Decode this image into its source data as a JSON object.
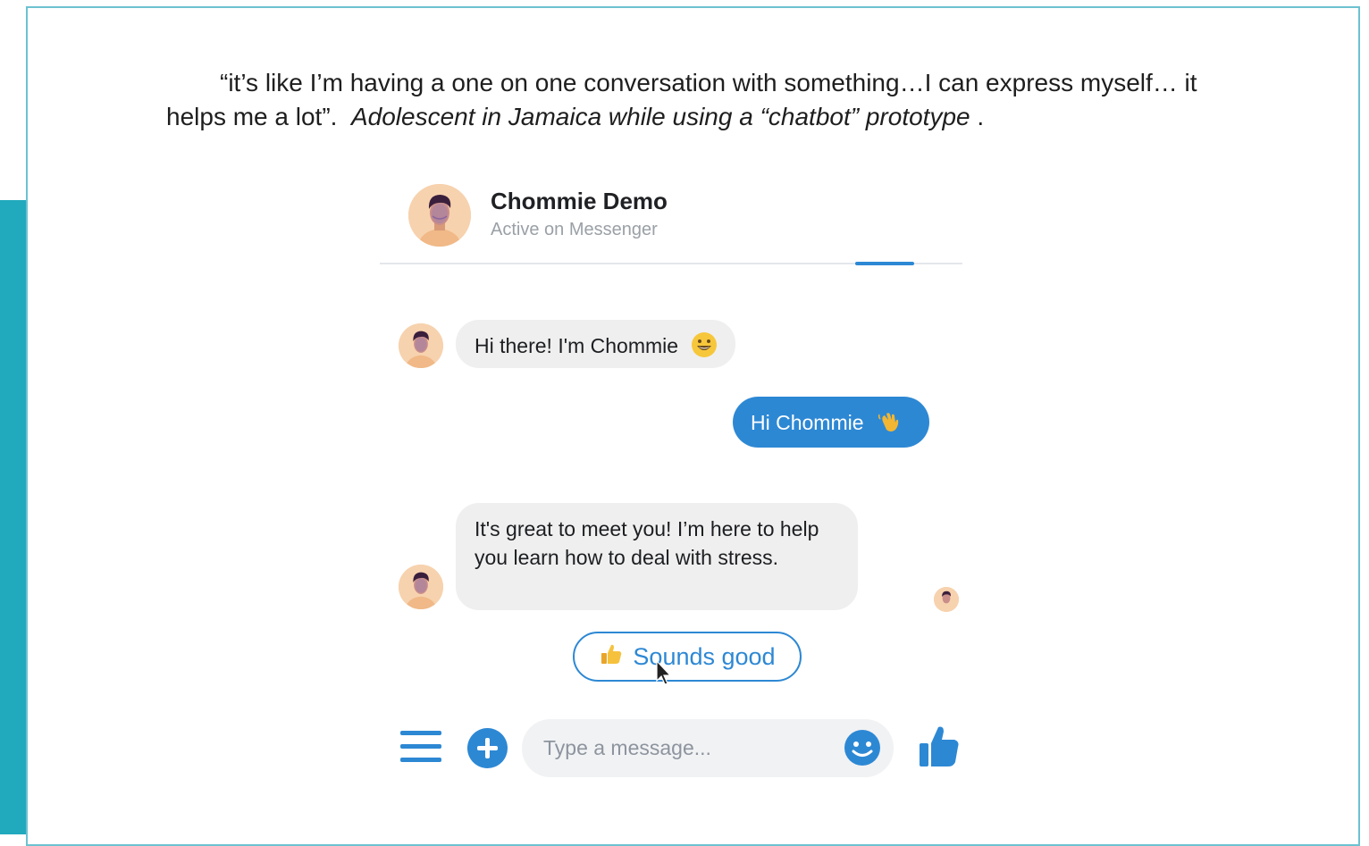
{
  "quote": {
    "text_line1": "“it’s like I’m having a one on one conversation with something…I can express myself… it",
    "text_line2_start": "helps me a lot”.",
    "attribution": "Adolescent in Jamaica while using a “chatbot” prototype",
    "trailing": " ."
  },
  "chat": {
    "contact_name": "Chommie Demo",
    "contact_status": "Active on Messenger",
    "messages": [
      {
        "from": "bot",
        "text": "Hi there! I'm Chommie",
        "emoji": "grinning-face"
      },
      {
        "from": "user",
        "text": "Hi Chommie",
        "emoji": "waving-hand"
      },
      {
        "from": "bot",
        "text": "It's great to meet you! I’m here to help you learn how to deal with stress."
      }
    ],
    "quick_reply": {
      "label": "Sounds good",
      "emoji": "thumbs-up"
    },
    "composer": {
      "placeholder": "Type a message..."
    }
  },
  "colors": {
    "accent": "#2d88d4",
    "teal_bar": "#21a9be",
    "bubble_in": "#efefef",
    "avatar_skin": "#f7d2ae"
  },
  "icons": [
    "menu-icon",
    "plus-icon",
    "emoji-icon",
    "thumbs-up-icon",
    "cursor-icon"
  ]
}
